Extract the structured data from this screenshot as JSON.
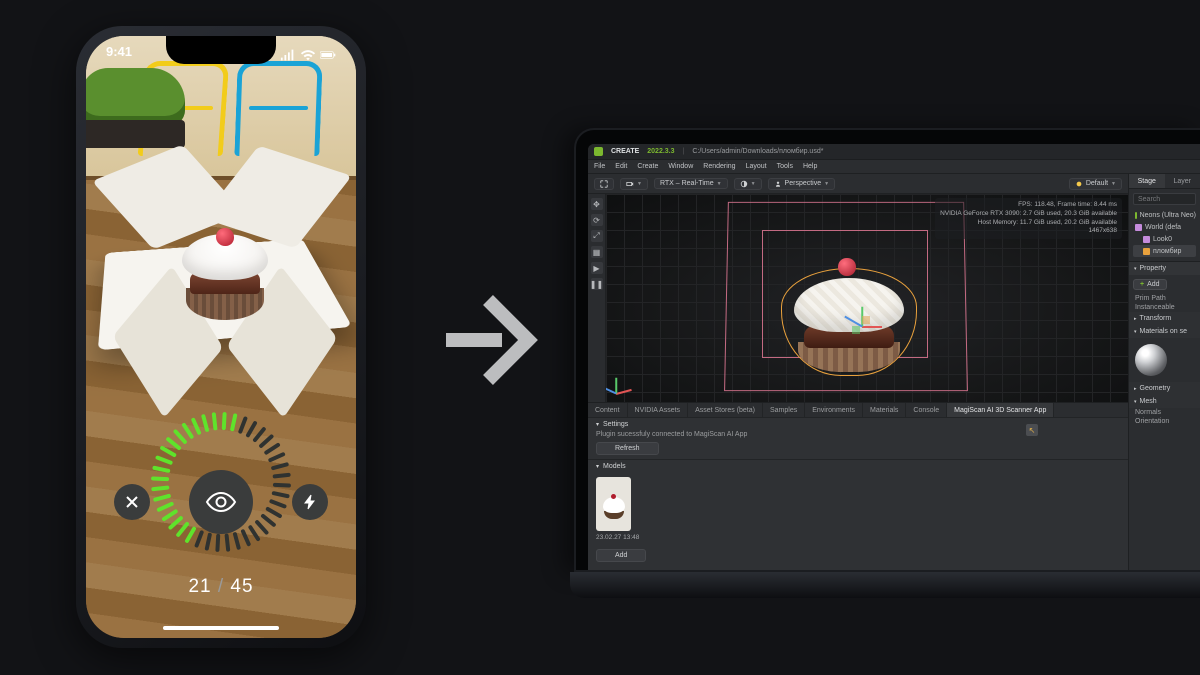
{
  "phone": {
    "clock": "9:41",
    "counter_current": "21",
    "counter_sep": " / ",
    "counter_total": "45"
  },
  "omniverse": {
    "app_name": "CREATE",
    "version": "2022.3.3",
    "file_path": "C:/Users/admin/Downloads/пломбир.usd*",
    "menu": [
      "File",
      "Edit",
      "Create",
      "Window",
      "Rendering",
      "Layout",
      "Tools",
      "Help"
    ],
    "viewport": {
      "renderer": "RTX – Real-Time",
      "camera_mode": "Perspective",
      "lighting_label": "Default",
      "stats": {
        "fps": "FPS: 118.48, Frame time: 8.44 ms",
        "gpu": "NVIDIA GeForce RTX 3090: 2.7 GiB used, 20.3 GiB available",
        "mem": "Host Memory: 11.7 GiB used, 20.2 GiB available",
        "res": "1467x638"
      }
    },
    "bottom_tabs": [
      "Content",
      "NVIDIA Assets",
      "Asset Stores (beta)",
      "Samples",
      "Environments",
      "Materials",
      "Console",
      "MagiScan AI 3D Scanner App"
    ],
    "bottom_tabs_active_index": 7,
    "panels": {
      "settings_title": "Settings",
      "status_text": "Plugin sucessfuly connected to MagiScan AI App",
      "refresh_label": "Refresh",
      "models_title": "Models",
      "model_timestamp": "23.02.27 13:48",
      "add_label": "Add"
    },
    "right": {
      "tabs": [
        "Stage",
        "Layer"
      ],
      "search_placeholder": "Search",
      "tree": [
        {
          "label": "Neons (Ultra Neo)",
          "icon": "a",
          "indent": 0
        },
        {
          "label": "World (defa",
          "icon": "b",
          "indent": 0
        },
        {
          "label": "Look0",
          "icon": "b",
          "indent": 1
        },
        {
          "label": "пломбир",
          "icon": "c",
          "indent": 1,
          "selected": true
        }
      ],
      "property_title": "Property",
      "add_btn": "Add",
      "prim_path_label": "Prim Path",
      "instanceable_label": "Instanceable",
      "sections": {
        "transform": "Transform",
        "materials": "Materials on se",
        "geometry": "Geometry",
        "mesh": "Mesh",
        "normals": "Normals",
        "orientation": "Orientation"
      }
    }
  }
}
